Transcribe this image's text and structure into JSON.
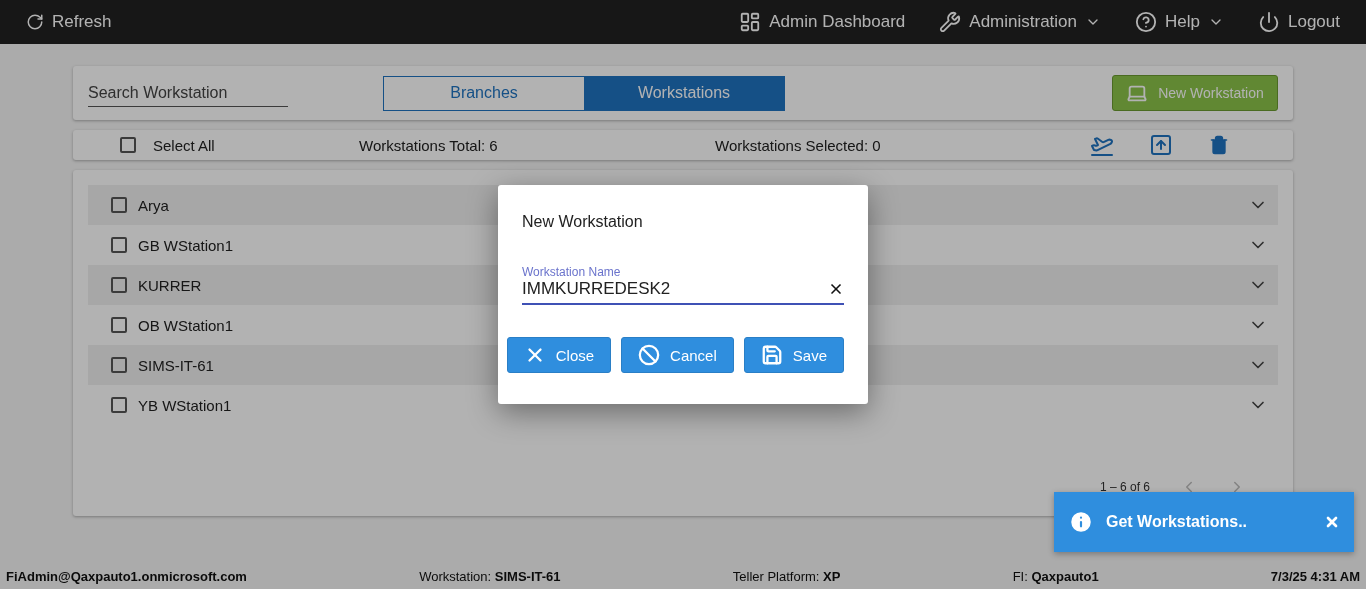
{
  "navbar": {
    "refresh": "Refresh",
    "items": [
      {
        "label": "Admin Dashboard",
        "kind": "link"
      },
      {
        "label": "Administration",
        "kind": "menu"
      },
      {
        "label": "Help",
        "kind": "menu"
      },
      {
        "label": "Logout",
        "kind": "link"
      }
    ]
  },
  "search": {
    "placeholder": "Search Workstation"
  },
  "tabs": [
    {
      "label": "Branches",
      "selected": false
    },
    {
      "label": "Workstations",
      "selected": true
    }
  ],
  "new_button": "New Workstation",
  "toolbar": {
    "select_all": {
      "label": "Select All",
      "checked": false
    },
    "total": "Workstations Total: 6",
    "selected_count": "Workstations Selected: 0"
  },
  "rows": [
    {
      "name": "Arya",
      "checked": false
    },
    {
      "name": "GB WStation1",
      "checked": false
    },
    {
      "name": "KURRER",
      "checked": false
    },
    {
      "name": "OB WStation1",
      "checked": false
    },
    {
      "name": "SIMS-IT-61",
      "checked": false
    },
    {
      "name": "YB WStation1",
      "checked": false
    }
  ],
  "pager": {
    "range": "1 – 6 of 6"
  },
  "dialog": {
    "title": "New Workstation",
    "field": {
      "label": "Workstation Name",
      "value": "IMMKURREDESK2"
    },
    "buttons": [
      {
        "label": "Close",
        "kind": "close"
      },
      {
        "label": "Cancel",
        "kind": "cancel"
      },
      {
        "label": "Save",
        "kind": "save"
      }
    ]
  },
  "toast": {
    "message": "Get Workstations.."
  },
  "status_bar": [
    {
      "value": "FiAdmin@Qaxpauto1.onmicrosoft.com"
    },
    {
      "label": "Workstation:",
      "value": "SIMS-IT-61"
    },
    {
      "label": "Teller Platform:",
      "value": "XP"
    },
    {
      "label": "FI:",
      "value": "Qaxpauto1"
    },
    {
      "value": "7/3/25 4:31 AM"
    }
  ]
}
